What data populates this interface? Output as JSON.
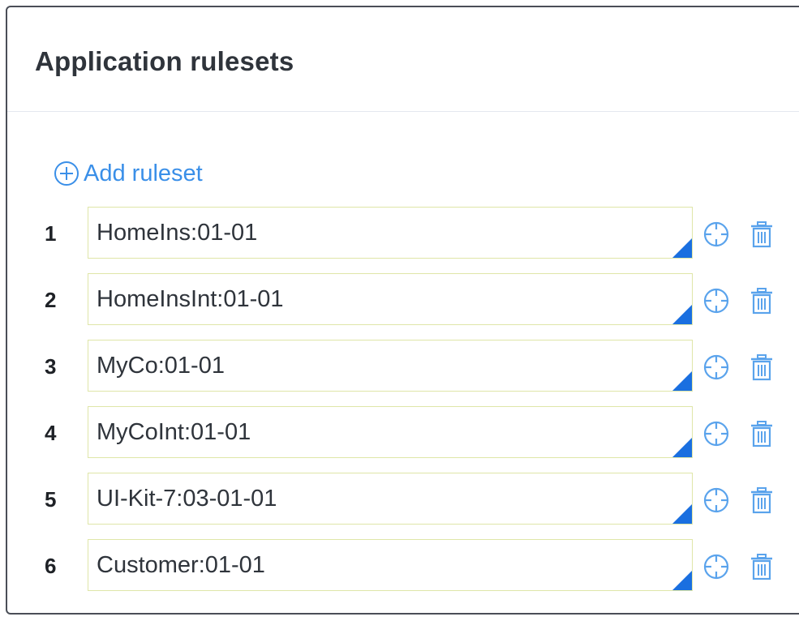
{
  "panel": {
    "title": "Application rulesets"
  },
  "add_button": {
    "label": "Add ruleset",
    "icon": "plus-circle-icon"
  },
  "rulesets": [
    {
      "index": "1",
      "value": "HomeIns:01-01"
    },
    {
      "index": "2",
      "value": "HomeInsInt:01-01"
    },
    {
      "index": "3",
      "value": "MyCo:01-01"
    },
    {
      "index": "4",
      "value": "MyCoInt:01-01"
    },
    {
      "index": "5",
      "value": "UI-Kit-7:03-01-01"
    },
    {
      "index": "6",
      "value": "Customer:01-01"
    }
  ],
  "row_icons": [
    "crosshair-icon",
    "trash-icon"
  ],
  "colors": {
    "accent": "#3a8fe8",
    "corner": "#1a6fe0",
    "field_border": "#dfe6a8",
    "icon": "#5aa3ec"
  }
}
